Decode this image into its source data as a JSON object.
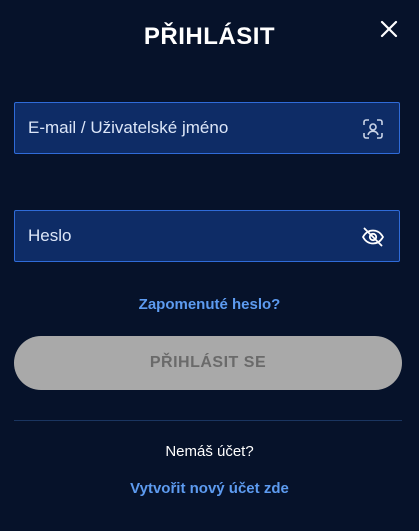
{
  "title": "PŘIHLÁSIT",
  "close": {
    "icon": "close-icon"
  },
  "email": {
    "placeholder": "E-mail / Uživatelské jméno",
    "value": "",
    "icon": "user-scan-icon"
  },
  "password": {
    "placeholder": "Heslo",
    "value": "",
    "icon": "eye-off-icon"
  },
  "forgot_label": "Zapomenuté heslo?",
  "submit_label": "PŘIHLÁSIT SE",
  "no_account_text": "Nemáš účet?",
  "create_account_label": "Vytvořit nový účet zde",
  "colors": {
    "background": "#06122a",
    "input_bg": "#0e2c66",
    "input_border": "#2f6bd8",
    "link": "#5d9bf0",
    "button_disabled_bg": "#a9a9a9",
    "button_disabled_text": "#6a6a6a"
  }
}
